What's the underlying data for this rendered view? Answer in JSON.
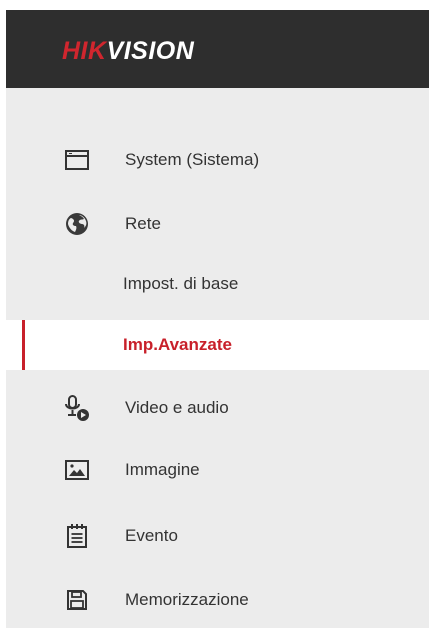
{
  "header": {
    "logo_part1": "HIK",
    "logo_part2": "VISION"
  },
  "sidebar": {
    "items": [
      {
        "label": "System (Sistema)",
        "icon": "window-icon"
      },
      {
        "label": "Rete",
        "icon": "globe-icon"
      },
      {
        "label": "Impost. di base",
        "icon": ""
      },
      {
        "label": "Imp.Avanzate",
        "icon": "",
        "active": true
      },
      {
        "label": "Video e audio",
        "icon": "mic-play-icon"
      },
      {
        "label": "Immagine",
        "icon": "image-icon"
      },
      {
        "label": "Evento",
        "icon": "calendar-icon"
      },
      {
        "label": "Memorizzazione",
        "icon": "save-icon"
      }
    ]
  },
  "colors": {
    "accent": "#c8202a",
    "header_bg": "#2e2e2e",
    "sidebar_bg": "#ececec"
  }
}
